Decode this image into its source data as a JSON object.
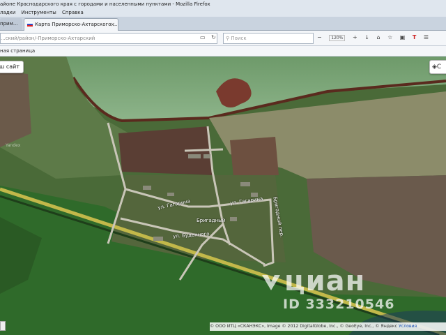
{
  "window": {
    "title": "айоне Краснодарского края с городами и населенными пунктами - Mozilla Firefox"
  },
  "menu": {
    "items": [
      "ладки",
      "Инструменты",
      "Справка"
    ]
  },
  "tabs": [
    {
      "label": "прим..."
    },
    {
      "label": "Карта Приморско-Ахтарского ..."
    }
  ],
  "newtab": "+",
  "nav": {
    "url": "...ский/район/-Приморско-Ахтарский",
    "search_placeholder": "Поиск",
    "zoom": "120%"
  },
  "bookmarks": {
    "label": "ная страница"
  },
  "map": {
    "site_button": "ш сайт",
    "layers_button": "С",
    "yandex_mark": "Yandex",
    "streets": {
      "gagarina_left": "ул. Гагарина",
      "gagarina_right": "ул. Гагарина",
      "brigadnaya": "Бригадный",
      "budennogo": "ул. Буденного",
      "brigadnaya_vertical": "Бригадный пер."
    },
    "attribution": "© ООО ИТЦ «СКАНЭКС», Image © 2012 DigitalGlobe, Inc., © GeoEye, Inc., © Яндекс",
    "attribution_link": "Условия",
    "watermark": {
      "brand": "циан",
      "id": "ID 333210546"
    }
  }
}
